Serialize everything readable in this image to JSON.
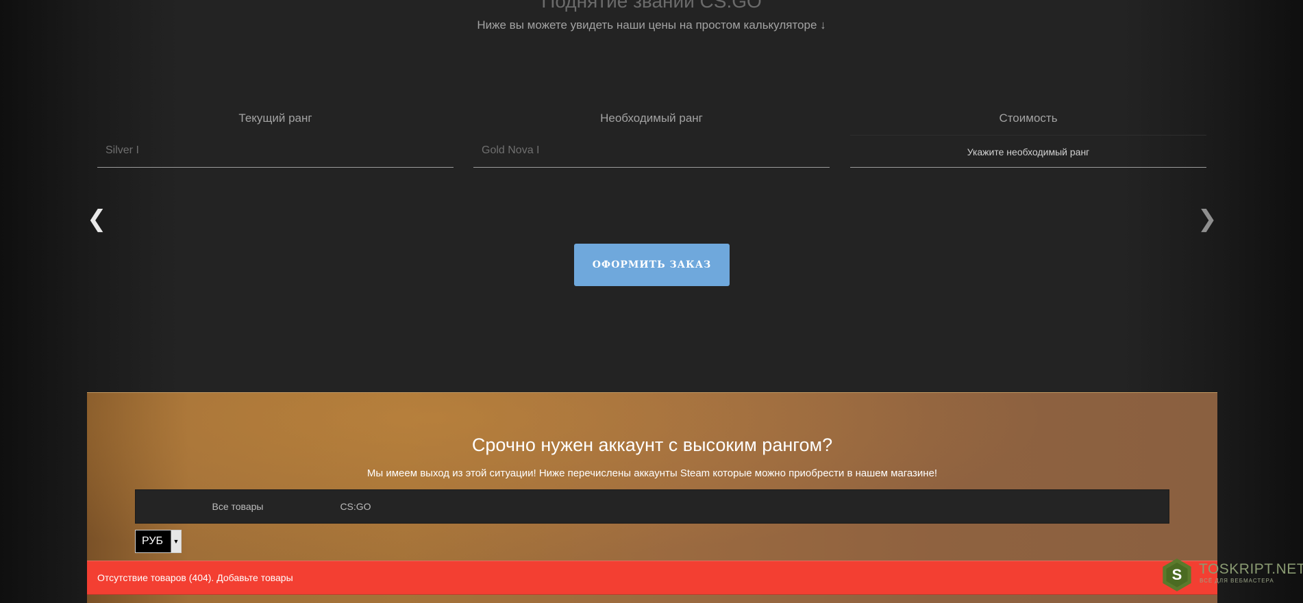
{
  "hero": {
    "title": "Поднятие званий CS:GO",
    "subtitle": "Ниже вы можете увидеть наши цены на простом калькуляторе ↓"
  },
  "calculator": {
    "current": {
      "label": "Текущий ранг",
      "value": "Silver I"
    },
    "required": {
      "label": "Необходимый ранг",
      "value": "Gold Nova I"
    },
    "price": {
      "label": "Стоимость",
      "value": "Укажите необходимый ранг"
    }
  },
  "carousel": {
    "prev_icon": "chevron-left-icon",
    "next_icon": "chevron-right-icon",
    "prev_glyph": "❮",
    "next_glyph": "❯"
  },
  "order_button": {
    "label": "ОФОРМИТЬ ЗАКАЗ",
    "color": "#6fa8dc"
  },
  "promo": {
    "title": "Срочно нужен аккаунт с высоким рангом?",
    "subtitle": "Мы имеем выход из этой ситуации! Ниже перечислены аккаунты Steam которые можно приобрести в нашем магазине!",
    "tabs": [
      "Все товары",
      "CS:GO"
    ],
    "currency": {
      "selected": "РУБ",
      "caret": "▼"
    },
    "error": {
      "text": "Отсутствие товаров (404). Добавьте товары",
      "color": "#f33f32"
    }
  },
  "watermark": {
    "badge_letter": "S",
    "name": "TOSKRIPT.NET",
    "tagline": "ВСЁ ДЛЯ ВЕБМАСТЕРА"
  }
}
